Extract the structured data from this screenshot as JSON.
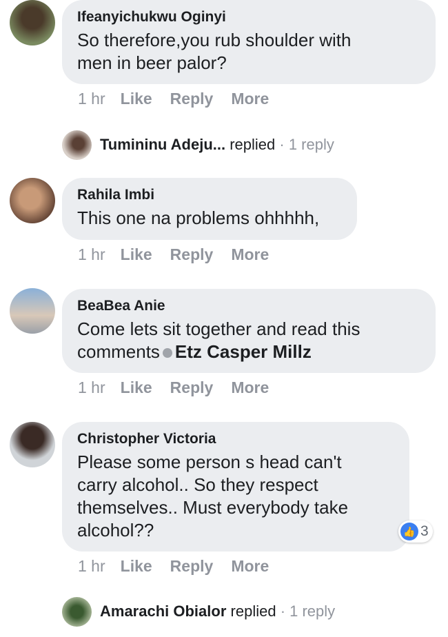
{
  "comments": [
    {
      "author": "Ifeanyichukwu Oginyi",
      "lines": [
        "So therefore,you rub shoulder with",
        "men in beer palor?"
      ],
      "time": "1 hr",
      "like": "Like",
      "reply": "Reply",
      "more": "More"
    },
    {
      "author": "Rahila Imbi",
      "lines": [
        "This one na problems ohhhhh,"
      ],
      "time": "1 hr",
      "like": "Like",
      "reply": "Reply",
      "more": "More"
    },
    {
      "author": "BeaBea Anie",
      "lines": [
        "Come lets sit together and read this",
        "comments"
      ],
      "tag": "Etz Casper Millz",
      "time": "1 hr",
      "like": "Like",
      "reply": "Reply",
      "more": "More"
    },
    {
      "author": "Christopher Victoria",
      "lines": [
        "Please some person s head can't",
        "carry alcohol.. So they respect",
        "themselves.. Must everybody take",
        "alcohol??"
      ],
      "reactions": {
        "icon": "thumbs-up-icon",
        "count": "3",
        "color": "#3b7ff0"
      },
      "time": "1 hr",
      "like": "Like",
      "reply": "Reply",
      "more": "More"
    }
  ],
  "replies": [
    {
      "author": "Tumininu Adeju...",
      "verb": "replied",
      "count": "· 1 reply"
    },
    {
      "author": "Amarachi Obialor",
      "verb": "replied",
      "count": "· 1 reply"
    }
  ]
}
